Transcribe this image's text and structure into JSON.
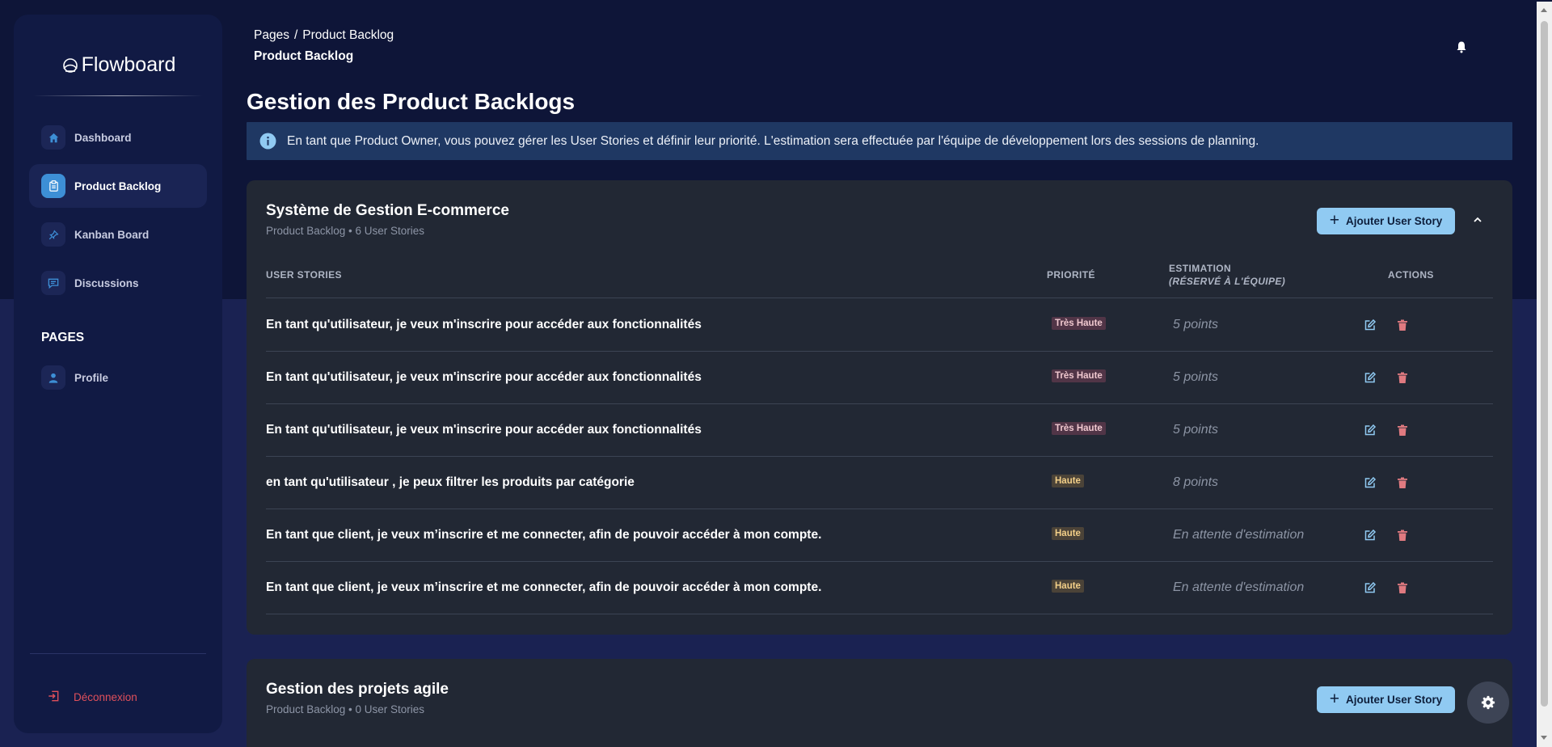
{
  "app": {
    "brand": "Flowboard"
  },
  "sidebar": {
    "items": [
      {
        "label": "Dashboard",
        "icon": "home-icon"
      },
      {
        "label": "Product Backlog",
        "icon": "clipboard-icon",
        "active": true
      },
      {
        "label": "Kanban Board",
        "icon": "pin-icon"
      },
      {
        "label": "Discussions",
        "icon": "chat-icon"
      }
    ],
    "pages_heading": "PAGES",
    "pages_items": [
      {
        "label": "Profile",
        "icon": "user-icon"
      }
    ],
    "logout_label": "Déconnexion"
  },
  "header": {
    "breadcrumb_root": "Pages",
    "breadcrumb_sep": "/",
    "breadcrumb_current": "Product Backlog",
    "subtitle": "Product Backlog"
  },
  "page": {
    "title": "Gestion des Product Backlogs",
    "info": "En tant que Product Owner, vous pouvez gérer les User Stories et définir leur priorité. L'estimation sera effectuée par l'équipe de développement lors des sessions de planning."
  },
  "table_headers": {
    "stories": "USER STORIES",
    "priority": "PRIORITÉ",
    "estimation": "ESTIMATION",
    "estimation_sub": "(RÉSERVÉ À L'ÉQUIPE)",
    "actions": "ACTIONS"
  },
  "projects": [
    {
      "title": "Système de Gestion E-commerce",
      "subtitle": "Product Backlog • 6 User Stories",
      "add_label": "Ajouter User Story",
      "stories": [
        {
          "text": "En tant qu'utilisateur, je veux m'inscrire pour accéder aux fonctionnalités",
          "priority": "Très Haute",
          "estimation": "5 points"
        },
        {
          "text": "En tant qu'utilisateur, je veux m'inscrire pour accéder aux fonctionnalités",
          "priority": "Très Haute",
          "estimation": "5 points"
        },
        {
          "text": "En tant qu'utilisateur, je veux m'inscrire pour accéder aux fonctionnalités",
          "priority": "Très Haute",
          "estimation": "5 points"
        },
        {
          "text": "en tant qu'utilisateur , je peux filtrer les produits par catégorie",
          "priority": "Haute",
          "estimation": "8 points"
        },
        {
          "text": "En tant que client, je veux m’inscrire et me connecter, afin de pouvoir accéder à mon compte.",
          "priority": "Haute",
          "estimation": "En attente d'estimation"
        },
        {
          "text": "En tant que client, je veux m’inscrire et me connecter, afin de pouvoir accéder à mon compte.",
          "priority": "Haute",
          "estimation": "En attente d'estimation"
        }
      ]
    },
    {
      "title": "Gestion des projets agile",
      "subtitle": "Product Backlog • 0 User Stories",
      "add_label": "Ajouter User Story"
    }
  ],
  "colors": {
    "accent": "#90caf2",
    "active_icon": "#3d8fd6",
    "danger": "#e0505b"
  }
}
